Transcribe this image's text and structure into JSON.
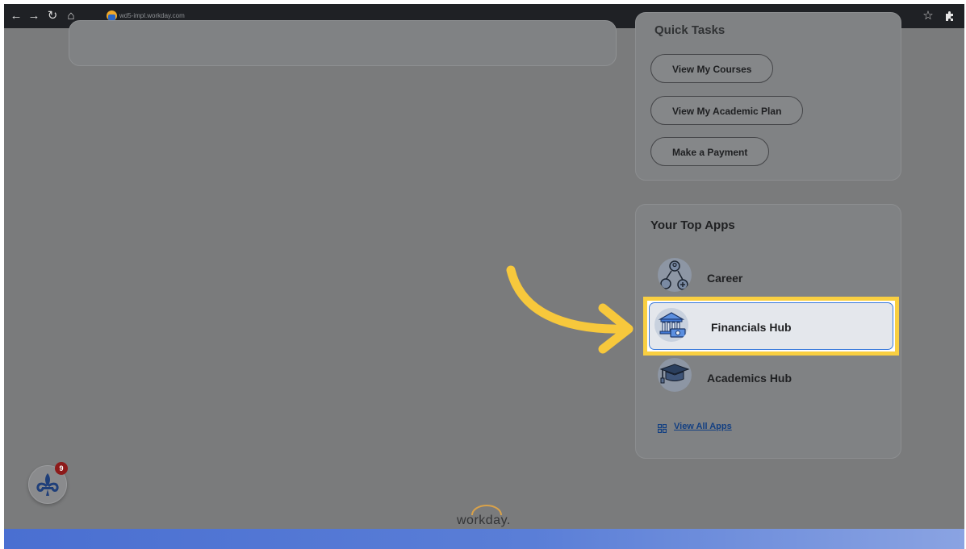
{
  "browser": {
    "url": "wd5-impl.workday.com",
    "icons": [
      "back-arrow-icon",
      "forward-arrow-icon",
      "reload-icon",
      "home-icon",
      "star-icon",
      "extensions-icon"
    ]
  },
  "quick_tasks": {
    "title": "Quick Tasks",
    "buttons": [
      "View My Courses",
      "View My Academic Plan",
      "Make a Payment"
    ]
  },
  "top_apps": {
    "title": "Your Top Apps",
    "apps": [
      {
        "label": "Career",
        "icon": "career-icon"
      },
      {
        "label": "Financials Hub",
        "icon": "bank-icon"
      },
      {
        "label": "Academics Hub",
        "icon": "graduation-cap-icon"
      }
    ],
    "view_all": "View All Apps"
  },
  "notifications": {
    "count": "9"
  },
  "brand": {
    "logo_text": "workday."
  },
  "colors": {
    "highlight": "#f9cf41",
    "arrow": "#f7c83c",
    "link": "#123f82",
    "footer": "#4a6fd1"
  }
}
